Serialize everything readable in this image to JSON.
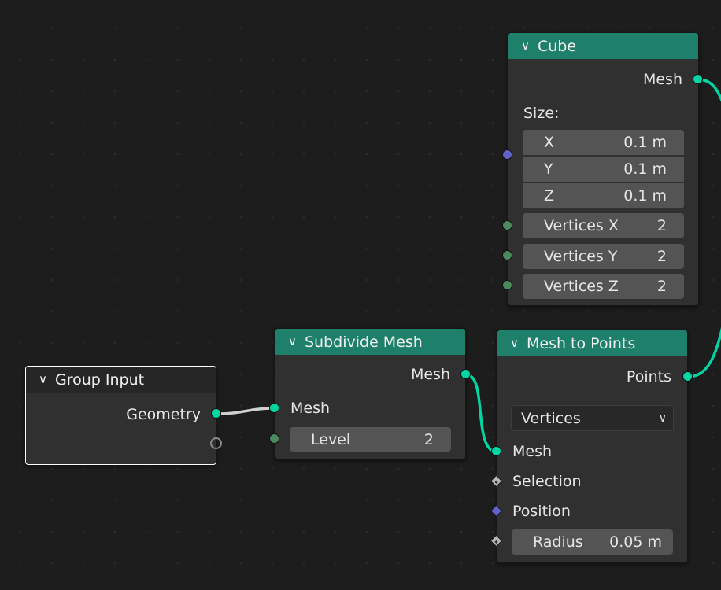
{
  "nodes": {
    "cube": {
      "title": "Cube",
      "output": "Mesh",
      "size_label": "Size:",
      "x_label": "X",
      "x_value": "0.1 m",
      "y_label": "Y",
      "y_value": "0.1 m",
      "z_label": "Z",
      "z_value": "0.1 m",
      "vx_label": "Vertices X",
      "vx_value": "2",
      "vy_label": "Vertices Y",
      "vy_value": "2",
      "vz_label": "Vertices Z",
      "vz_value": "2"
    },
    "group_input": {
      "title": "Group Input",
      "output": "Geometry"
    },
    "subdivide": {
      "title": "Subdivide Mesh",
      "output": "Mesh",
      "input_mesh": "Mesh",
      "level_label": "Level",
      "level_value": "2"
    },
    "mesh_to_points": {
      "title": "Mesh to Points",
      "output": "Points",
      "mode": "Vertices",
      "input_mesh": "Mesh",
      "selection": "Selection",
      "position": "Position",
      "radius_label": "Radius",
      "radius_value": "0.05 m"
    }
  },
  "chevron": "∨",
  "colors": {
    "background": "#1d1d1d",
    "node_body": "#303030",
    "geometry_header": "#1e7f6a",
    "geometry_socket": "#00d6a3",
    "integer_socket": "#4a8a5c",
    "vector_socket": "#6363c7",
    "link": "#00d6a3"
  }
}
